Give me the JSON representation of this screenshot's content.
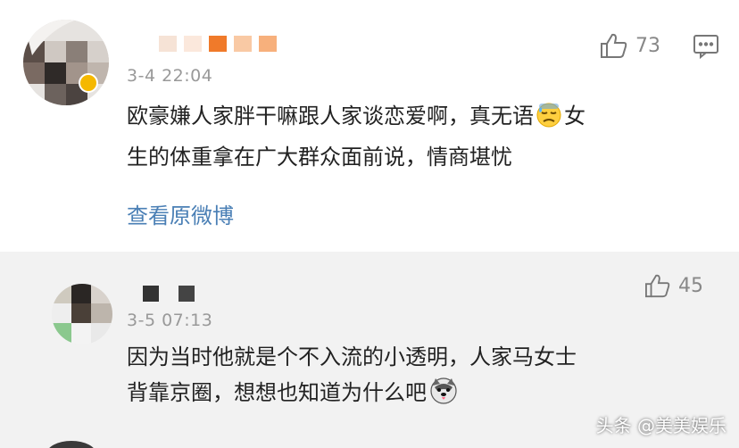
{
  "comments": [
    {
      "time": "3-4 22:04",
      "like_count": "73",
      "text_line1": "欧豪嫌人家胖干嘛跟人家谈恋爱啊，真无语",
      "text_line1_after": "女",
      "text_line2": "生的体重拿在广大群众面前说，情商堪忧",
      "view_original": "查看原微博",
      "emoji_icon": "sweat-face-emoji-icon"
    },
    {
      "time": "3-5 07:13",
      "like_count": "45",
      "text_line1": "因为当时他就是个不入流的小透明，人家马女士",
      "text_line2": "背靠京圈，想想也知道为什么吧",
      "emoji_icon": "husky-face-emoji-icon"
    }
  ],
  "watermark": "头条 @美美娱乐",
  "colors": {
    "link": "#4a7fb5",
    "timestamp": "#999999",
    "second_comment_bg": "#f2f2f2",
    "name_orange": "#f07a2a"
  }
}
